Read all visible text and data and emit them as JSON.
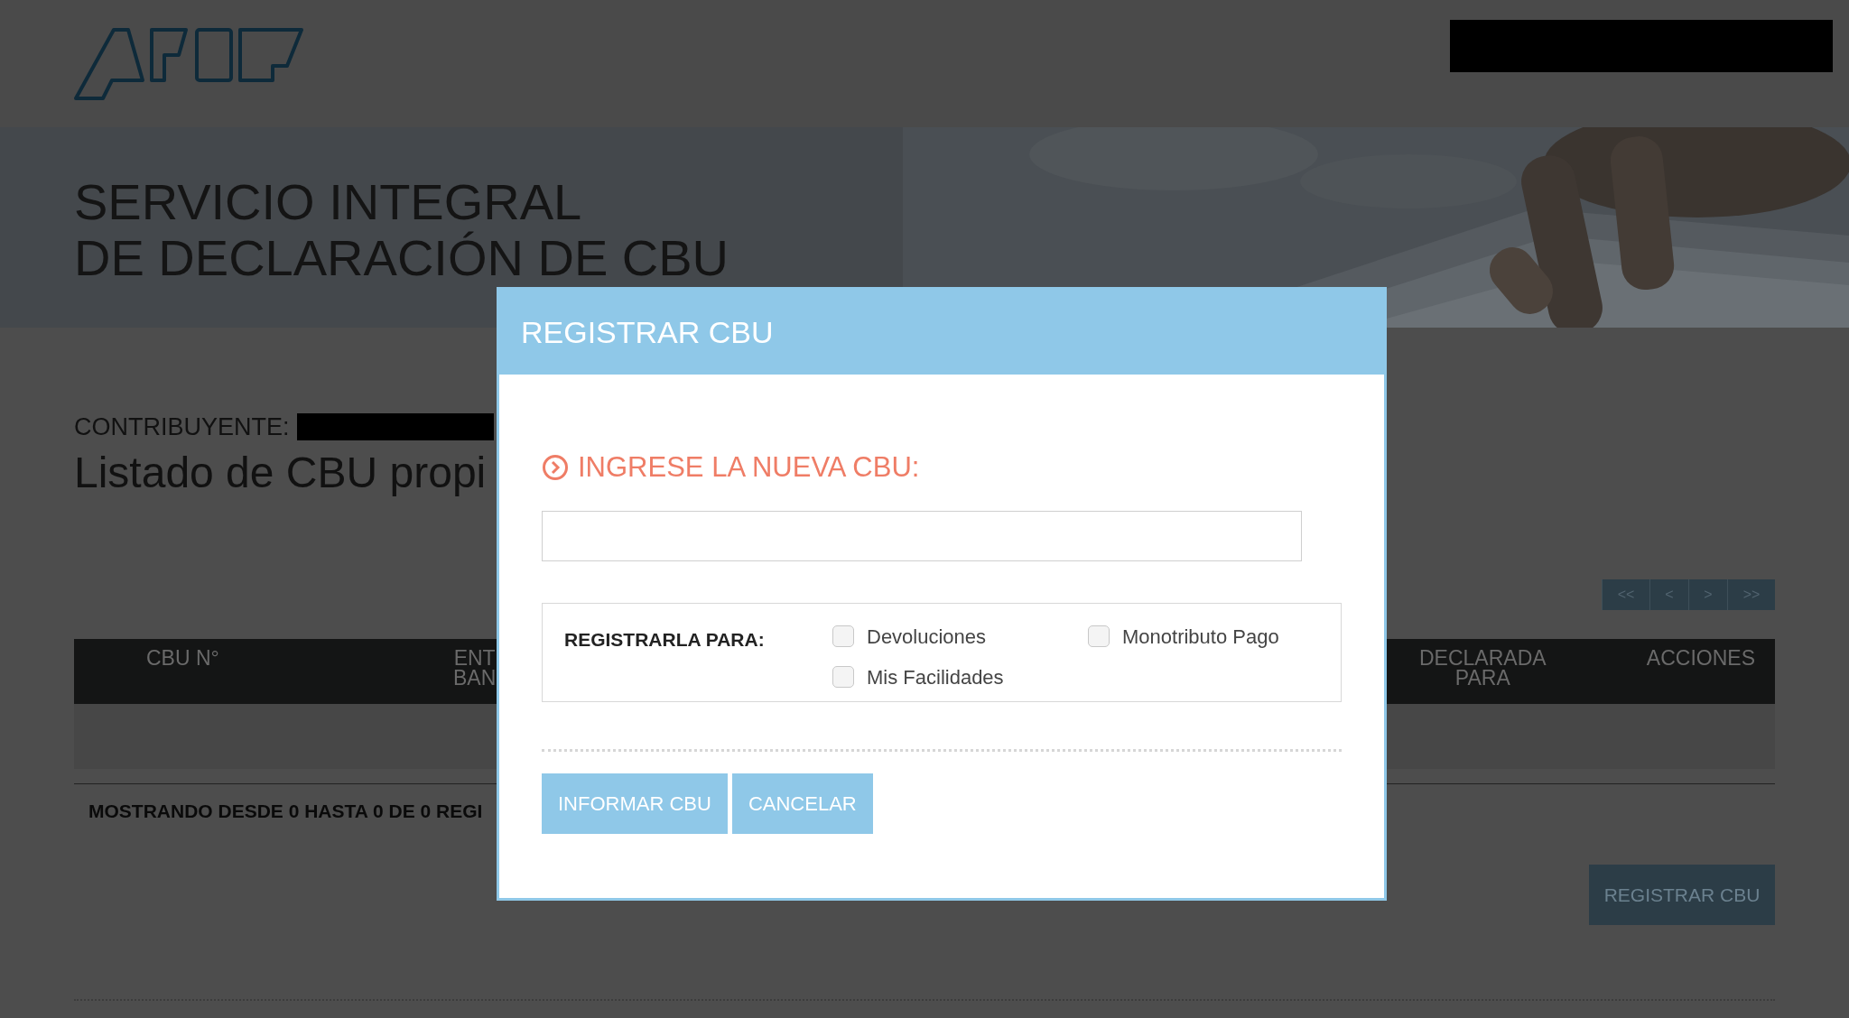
{
  "banner": {
    "title_lines": [
      "SERVICIO INTEGRAL",
      "DE DECLARACIÓN DE CBU"
    ]
  },
  "contribuyente": {
    "label": "CONTRIBUYENTE:"
  },
  "heading": "Listado de CBU propi",
  "pager": [
    "<<",
    "<",
    ">",
    ">>"
  ],
  "table": {
    "columns": [
      {
        "lines": [
          "CBU N°"
        ]
      },
      {
        "lines": [
          "ENT",
          "BAN"
        ]
      },
      {
        "lines": [
          "DECLARADA",
          "PARA"
        ]
      },
      {
        "lines": [
          "ACCIONES"
        ]
      }
    ]
  },
  "summary": "MOSTRANDO DESDE 0 HASTA 0 DE 0 REGI",
  "register_button": "REGISTRAR CBU",
  "modal": {
    "title": "REGISTRAR CBU",
    "prompt": "INGRESE LA NUEVA CBU:",
    "register_for": {
      "label": "REGISTRARLA PARA:",
      "options": [
        {
          "label": "Devoluciones",
          "checked": false
        },
        {
          "label": "Monotributo Pago",
          "checked": false
        },
        {
          "label": "Mis Facilidades",
          "checked": false
        }
      ]
    },
    "buttons": [
      "INFORMAR CBU",
      "CANCELAR"
    ]
  }
}
